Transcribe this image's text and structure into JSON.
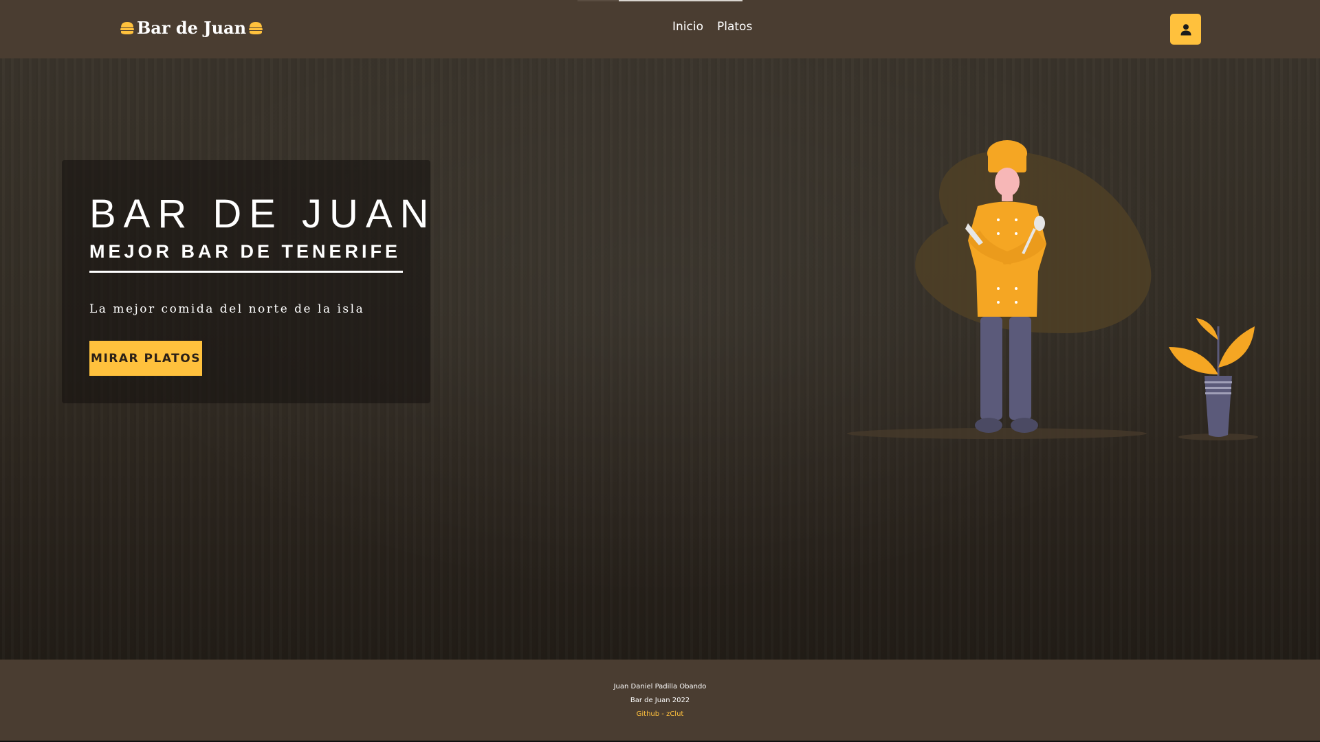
{
  "brand": {
    "name": "Bar de Juan",
    "icon": "burger-icon"
  },
  "nav": {
    "items": [
      {
        "label": "Inicio"
      },
      {
        "label": "Platos"
      }
    ],
    "user_icon": "user-icon"
  },
  "hero": {
    "title": "BAR DE JUAN",
    "subtitle": "MEJOR BAR DE TENERIFE",
    "tagline": "La mejor comida del norte de la isla",
    "cta_label": "MIRAR PLATOS",
    "illustration_icons": [
      "chef-illustration",
      "plant-pot-icon"
    ]
  },
  "footer": {
    "author": "Juan Daniel Padilla Obando",
    "copyright": "Bar de Juan 2022",
    "link_label": "Github - zClut"
  },
  "colors": {
    "navbar_bg": "#4a3d31",
    "accent": "#ffc13d",
    "text": "#ffffff"
  }
}
